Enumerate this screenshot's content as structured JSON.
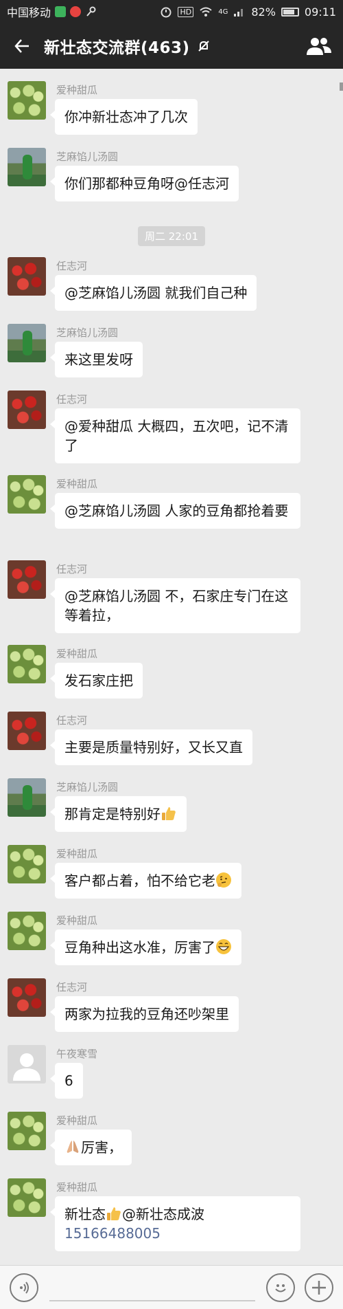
{
  "status": {
    "carrier": "中国移动",
    "signal": "4G",
    "hd": "HD",
    "battery": "82%",
    "battery_level": 0.82,
    "time": "09:11"
  },
  "header": {
    "title": "新壮态交流群(463)"
  },
  "chat": {
    "time_divider": "周二 22:01",
    "messages": [
      {
        "sender": "爱种甜瓜",
        "text": "你冲新壮态冲了几次",
        "avatar": "melon-avatar"
      },
      {
        "sender": "芝麻馅儿汤圆",
        "text": "你们那都种豆角呀@任志河",
        "avatar": "kid-avatar"
      },
      {
        "sender": "任志河",
        "text": "@芝麻馅儿汤圆 就我们自己种",
        "avatar": "strawberry-avatar"
      },
      {
        "sender": "芝麻馅儿汤圆",
        "text": "来这里发呀",
        "avatar": "kid-avatar"
      },
      {
        "sender": "任志河",
        "text": "@爱种甜瓜 大概四，五次吧，记不清了",
        "avatar": "strawberry-avatar"
      },
      {
        "sender": "爱种甜瓜",
        "text": "@芝麻馅儿汤圆 人家的豆角都抢着要",
        "avatar": "melon-avatar"
      },
      {
        "sender": "任志河",
        "text": "@芝麻馅儿汤圆 不，石家庄专门在这等着拉，",
        "avatar": "strawberry-avatar"
      },
      {
        "sender": "爱种甜瓜",
        "text": "发石家庄把",
        "avatar": "melon-avatar"
      },
      {
        "sender": "任志河",
        "text": "主要是质量特别好，又长又直",
        "avatar": "strawberry-avatar"
      },
      {
        "sender": "芝麻馅儿汤圆",
        "text": "那肯定是特别好",
        "avatar": "kid-avatar"
      },
      {
        "sender": "爱种甜瓜",
        "text": "客户都占着，怕不给它老",
        "avatar": "melon-avatar"
      },
      {
        "sender": "爱种甜瓜",
        "text": "豆角种出这水准，厉害了",
        "avatar": "melon-avatar"
      },
      {
        "sender": "任志河",
        "text": "两家为拉我的豆角还吵架里",
        "avatar": "strawberry-avatar"
      },
      {
        "sender": "午夜寒雪",
        "text": "6",
        "avatar": "default-avatar"
      },
      {
        "sender": "爱种甜瓜",
        "text": "厉害，",
        "avatar": "melon-avatar"
      },
      {
        "sender": "爱种甜瓜",
        "text_a": "新壮态",
        "text_b": "@新壮态成波",
        "phone": "15166488005",
        "avatar": "melon-avatar"
      }
    ]
  },
  "colors": {
    "bar": "#262626",
    "background": "#ebebeb",
    "bubble": "#ffffff",
    "link": "#576b95"
  }
}
